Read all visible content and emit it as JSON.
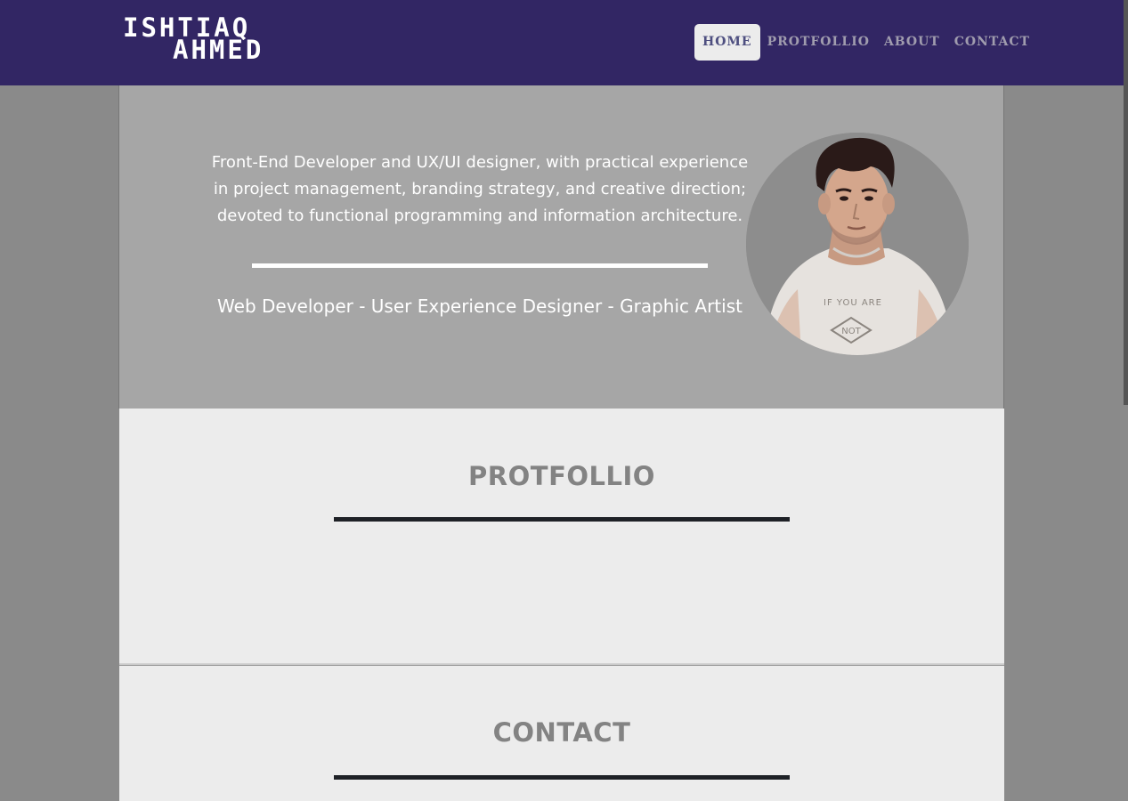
{
  "brand": {
    "line1": "ISHTIAQ",
    "line2": "AHMED"
  },
  "nav": {
    "items": [
      {
        "label": "HOME",
        "active": true
      },
      {
        "label": "PROTFOLLIO",
        "active": false
      },
      {
        "label": "ABOUT",
        "active": false
      },
      {
        "label": "CONTACT",
        "active": false
      }
    ]
  },
  "hero": {
    "intro": "Front-End Developer and UX/UI designer, with practical experience in project management, branding strategy, and creative direction; devoted to functional programming and information architecture.",
    "roles": "Web Developer - User Experience Designer - Graphic Artist",
    "avatar_shirt_text": "IF YOU ARE NOT"
  },
  "sections": {
    "portfolio_title": "PROTFOLLIO",
    "contact_title": "CONTACT"
  },
  "colors": {
    "navbar": "#322664",
    "page_bg": "#8a8a8a",
    "hero_bg": "#a6a6a6",
    "section_bg": "#ececec",
    "heading": "#838383",
    "rule_dark": "#1e2126",
    "nav_active_text": "#4e4f80"
  }
}
